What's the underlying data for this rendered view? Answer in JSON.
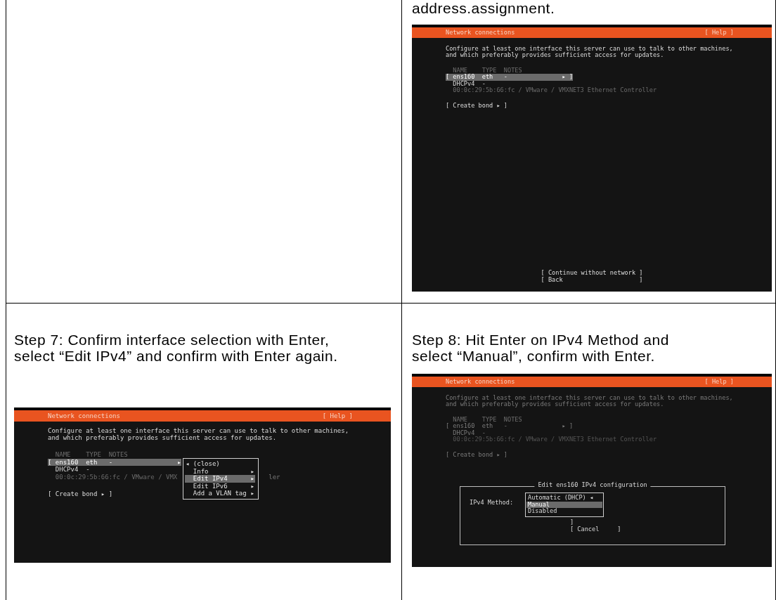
{
  "table": {
    "rows": [
      {
        "cells": [
          {
            "kind": "empty"
          },
          {
            "kind": "step",
            "text": "address.assignment.",
            "screen": {
              "title": "Network connections",
              "help": "[ Help ]",
              "dimmed": false,
              "intro": [
                "Configure at least one interface this server can use to talk to other machines,",
                "and which preferably provides sufficient access for updates."
              ],
              "header": "NAME    TYPE  NOTES",
              "rows": [
                {
                  "kind": "interface",
                  "text": "[ ens160  eth   -               ▸ ]",
                  "selected": true
                },
                {
                  "kind": "detail",
                  "text": "DHCPv4  -"
                },
                {
                  "kind": "hardware",
                  "text": "00:0c:29:5b:66:fc / VMware / VMXNET3 Ethernet Controller"
                }
              ],
              "create_bond": "[ Create bond ▸ ]",
              "footer": [
                "[ Continue without network ]",
                "[ Back                     ]"
              ]
            }
          }
        ]
      },
      {
        "cells": [
          {
            "kind": "step",
            "text": "Step 7: Confirm interface selection with Enter, select “Edit IPv4” and confirm with Enter again.",
            "screen": {
              "title": "Network connections",
              "help": "[ Help ]",
              "dimmed": false,
              "intro": [
                "Configure at least one interface this server can use to talk to other machines,",
                "and which preferably provides sufficient access for updates."
              ],
              "header": "NAME    TYPE  NOTES",
              "rows": [
                {
                  "kind": "interface",
                  "text": "[ ens160  eth   -                 ▸",
                  "selected": true
                },
                {
                  "kind": "detail",
                  "text": "DHCPv4  -"
                },
                {
                  "kind": "hardware",
                  "text": "00:0c:29:5b:66:fc / VMware / VMX",
                  "tail": "ler"
                }
              ],
              "create_bond": "[ Create bond ▸ ]",
              "menu": [
                {
                  "lead": "◂",
                  "label": "(close)",
                  "selected": false
                },
                {
                  "label": "Info",
                  "arrow": "▸",
                  "selected": false
                },
                {
                  "label": "Edit IPv4",
                  "arrow": "▸",
                  "selected": true
                },
                {
                  "label": "Edit IPv6",
                  "arrow": "▸",
                  "selected": false
                },
                {
                  "label": "Add a VLAN tag",
                  "arrow": "▸",
                  "selected": false
                }
              ]
            }
          },
          {
            "kind": "step",
            "text": "Step 8: Hit Enter on IPv4 Method and select “Manual”, confirm with Enter.",
            "screen": {
              "title": "Network connections",
              "help": "[ Help ]",
              "dimmed": true,
              "intro": [
                "Configure at least one interface this server can use to talk to other machines,",
                "and which preferably provides sufficient access for updates."
              ],
              "header": "NAME    TYPE  NOTES",
              "rows": [
                {
                  "kind": "interface",
                  "text": "[ ens160  eth   -               ▸ ]",
                  "selected": false
                },
                {
                  "kind": "detail",
                  "text": "DHCPv4  -"
                },
                {
                  "kind": "hardware",
                  "text": "00:0c:29:5b:66:fc / VMware / VMXNET3 Ethernet Controller"
                }
              ],
              "create_bond": "[ Create bond ▸ ]",
              "dialog": {
                "title": "Edit ens160 IPv4 configuration",
                "label": "IPv4 Method:",
                "options": [
                  {
                    "label": "Automatic (DHCP)",
                    "marker": "◂",
                    "selected": false
                  },
                  {
                    "label": "Manual",
                    "selected": true
                  },
                  {
                    "label": "Disabled",
                    "selected": false
                  }
                ],
                "buttons": [
                  "]",
                  "[ Cancel     ]"
                ]
              }
            }
          }
        ]
      }
    ]
  }
}
